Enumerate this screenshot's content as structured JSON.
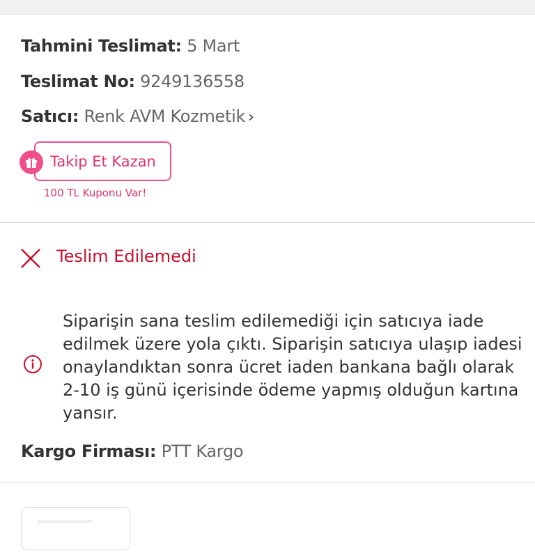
{
  "delivery": {
    "estimated_label": "Tahmini Teslimat:",
    "estimated_value": "5 Mart",
    "tracking_label": "Teslimat No:",
    "tracking_value": "9249136558",
    "seller_label": "Satıcı:",
    "seller_value": "Renk AVM Kozmetik",
    "seller_chevron": "›"
  },
  "follow": {
    "button_label": "Takip Et Kazan",
    "coupon_text": "100 TL Kuponu Var!",
    "icon": "gift-icon"
  },
  "status": {
    "title": "Teslim Edilemedi",
    "icon": "x-icon",
    "color": "#c8102e"
  },
  "notice": {
    "icon": "info-icon",
    "text": "Siparişin sana teslim edilemediği için satıcıya iade edilmek üzere yola çıktı. Siparişin satıcıya ulaşıp iadesi onaylandıktan sonra ücret iaden bankana bağlı olarak 2-10 iş günü içerisinde ödeme yapmış olduğun kartına yansır."
  },
  "cargo": {
    "label": "Kargo Firması:",
    "value": "PTT Kargo"
  },
  "colors": {
    "accent_pink": "#f0508a",
    "error_red": "#c8102e"
  }
}
